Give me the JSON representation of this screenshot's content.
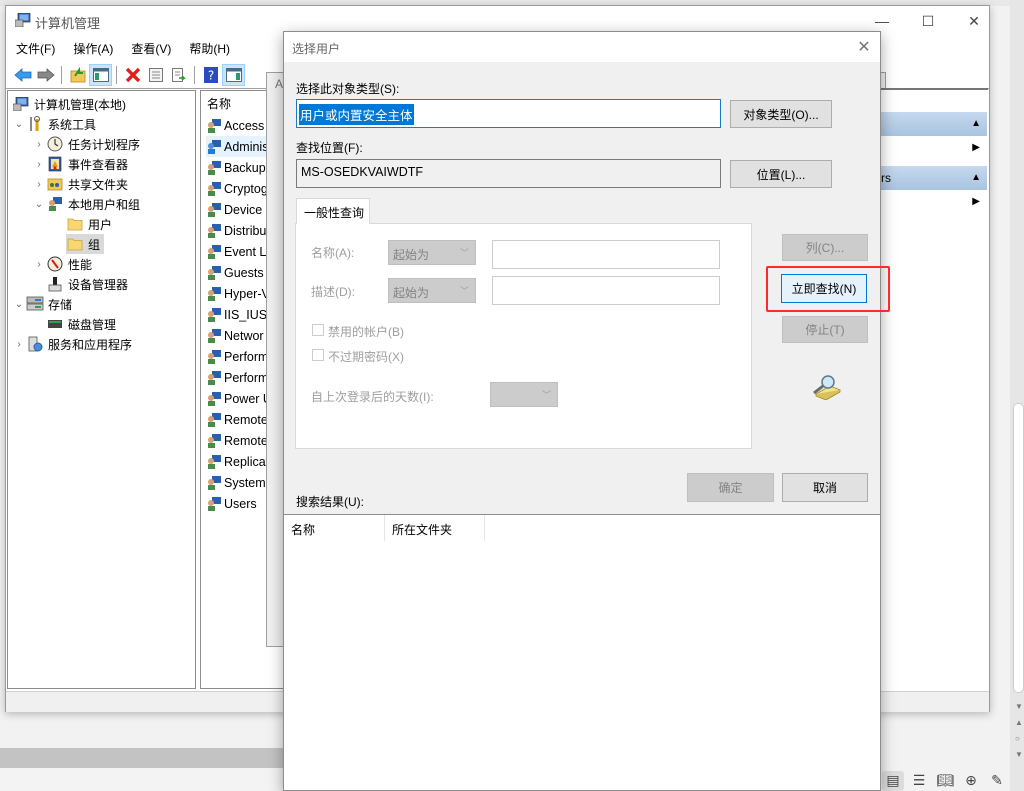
{
  "mmc": {
    "title": "计算机管理",
    "window_controls": {
      "minimize": "—",
      "maximize": "☐",
      "close": "✕"
    },
    "menus": [
      "文件(F)",
      "操作(A)",
      "查看(V)",
      "帮助(H)"
    ],
    "toolbar": [
      "back-arrow-icon",
      "forward-arrow-icon",
      "up-folder-icon",
      "show-hide-tree-icon",
      "delete-icon",
      "properties-icon",
      "export-list-icon",
      "help-icon",
      "show-hide-action-pane-icon"
    ],
    "tree": [
      {
        "label": "计算机管理(本地)",
        "level": 0,
        "expander": "",
        "icon": "computer-management-icon"
      },
      {
        "label": "系统工具",
        "level": 1,
        "expander": "⌄",
        "icon": "system-tools-icon"
      },
      {
        "label": "任务计划程序",
        "level": 2,
        "expander": "›",
        "icon": "task-scheduler-icon"
      },
      {
        "label": "事件查看器",
        "level": 2,
        "expander": "›",
        "icon": "event-viewer-icon"
      },
      {
        "label": "共享文件夹",
        "level": 2,
        "expander": "›",
        "icon": "shared-folders-icon"
      },
      {
        "label": "本地用户和组",
        "level": 2,
        "expander": "⌄",
        "icon": "local-users-groups-icon"
      },
      {
        "label": "用户",
        "level": 3,
        "expander": "",
        "icon": "folder-icon"
      },
      {
        "label": "组",
        "level": 3,
        "expander": "",
        "icon": "folder-icon",
        "selected": true
      },
      {
        "label": "性能",
        "level": 2,
        "expander": "›",
        "icon": "performance-icon"
      },
      {
        "label": "设备管理器",
        "level": 2,
        "expander": "",
        "icon": "device-manager-icon"
      },
      {
        "label": "存储",
        "level": 1,
        "expander": "⌄",
        "icon": "storage-icon"
      },
      {
        "label": "磁盘管理",
        "level": 2,
        "expander": "",
        "icon": "disk-management-icon"
      },
      {
        "label": "服务和应用程序",
        "level": 1,
        "expander": "›",
        "icon": "services-apps-icon"
      }
    ],
    "list_header": "名称",
    "groups": [
      "Access",
      "Adminis",
      "Backup",
      "Cryptog",
      "Device",
      "Distribu",
      "Event Lo",
      "Guests",
      "Hyper-V",
      "IIS_IUSR",
      "Networ",
      "Perform",
      "Perform",
      "Power U",
      "Remote",
      "Remote",
      "Replicat",
      "System",
      "Users"
    ],
    "actions_pane": {
      "section2_partial": "rs"
    },
    "background_dialog_title_partial": "A"
  },
  "dialog": {
    "title": "选择用户",
    "object_type_label": "选择此对象类型(S):",
    "object_type_label_key": "S",
    "object_type_value": "用户或内置安全主体",
    "object_types_button": "对象类型(O)...",
    "location_label": "查找位置(F):",
    "location_value": "MS-OSEDKVAIWDTF",
    "locations_button": "位置(L)...",
    "tab_label": "一般性查询",
    "name_label": "名称(A):",
    "name_mode": "起始为",
    "name_value": "",
    "description_label": "描述(D):",
    "description_mode": "起始为",
    "description_value": "",
    "disabled_accounts_label": "禁用的帐户(B)",
    "disabled_accounts_checked": false,
    "non_expiring_label": "不过期密码(X)",
    "non_expiring_checked": false,
    "days_since_logon_label": "自上次登录后的天数(I):",
    "days_since_logon_value": "",
    "columns_button": "列(C)...",
    "find_now_button": "立即查找(N)",
    "stop_button": "停止(T)",
    "ok_button": "确定",
    "cancel_button": "取消",
    "results_label": "搜索结果(U):",
    "results_columns": [
      "名称",
      "所在文件夹"
    ],
    "results_rows": []
  },
  "highlight_color": "#ff2a2a",
  "accent_color": "#0078d7",
  "taskbar_icons": [
    "document-icon",
    "list-icon",
    "book-icon",
    "globe-icon",
    "pen-icon"
  ]
}
